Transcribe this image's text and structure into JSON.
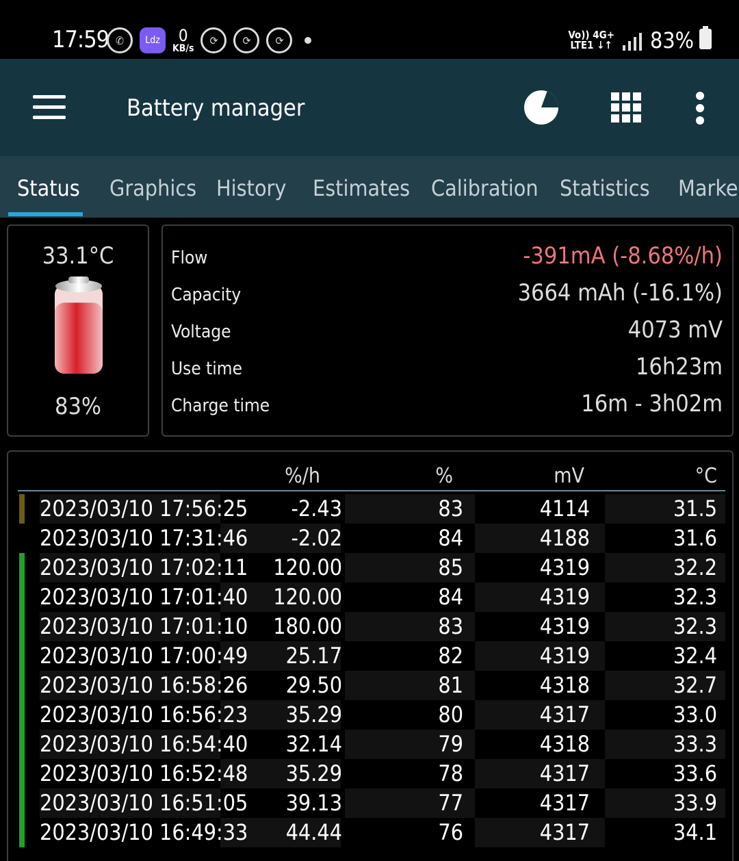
{
  "status_bar": {
    "time": "17:59",
    "net_speed_value": "0",
    "net_speed_unit": "KB/s",
    "ldz_label": "Ldz",
    "network_top": "Vo)) 4G+",
    "network_bottom": "LTE1 ↓↑",
    "battery_percent": "83%",
    "icons": [
      "whatsapp-icon",
      "ldz-app-icon",
      "sync-icon",
      "sync-icon",
      "sync-icon",
      "dot-icon",
      "signal-icon",
      "battery-icon"
    ]
  },
  "app_bar": {
    "title": "Battery manager",
    "icons": [
      "menu-icon",
      "pie-chart-icon",
      "grid-icon",
      "more-vert-icon"
    ]
  },
  "tabs": [
    {
      "label": "Status",
      "active": true
    },
    {
      "label": "Graphics"
    },
    {
      "label": "History"
    },
    {
      "label": "Estimates"
    },
    {
      "label": "Calibration"
    },
    {
      "label": "Statistics"
    },
    {
      "label": "Marker"
    }
  ],
  "battery_summary": {
    "temperature": "33.1°C",
    "level": "83%",
    "level_fraction": 0.83
  },
  "details": [
    {
      "label": "Flow",
      "value": "-391mA (-8.68%/h)"
    },
    {
      "label": "Capacity",
      "value": "3664 mAh (-16.1%)"
    },
    {
      "label": "Voltage",
      "value": "4073 mV"
    },
    {
      "label": "Use time",
      "value": "16h23m"
    },
    {
      "label": "Charge time",
      "value": "16m - 3h02m"
    }
  ],
  "history_table": {
    "headers": [
      "%/h",
      "%",
      "mV",
      "°C"
    ],
    "rows": [
      {
        "ts": "2023/03/10  17:56:25",
        "rate": "-2.43",
        "pct": "83",
        "mv": "4114",
        "temp": "31.5",
        "marker": "#6b5d12"
      },
      {
        "ts": "2023/03/10  17:31:46",
        "rate": "-2.02",
        "pct": "84",
        "mv": "4188",
        "temp": "31.6",
        "marker": ""
      },
      {
        "ts": "2023/03/10  17:02:11",
        "rate": "120.00",
        "pct": "85",
        "mv": "4319",
        "temp": "32.2",
        "marker": "#1ea12a"
      },
      {
        "ts": "2023/03/10  17:01:40",
        "rate": "120.00",
        "pct": "84",
        "mv": "4319",
        "temp": "32.3",
        "marker": "#1ea12a"
      },
      {
        "ts": "2023/03/10  17:01:10",
        "rate": "180.00",
        "pct": "83",
        "mv": "4319",
        "temp": "32.3",
        "marker": "#1ea12a"
      },
      {
        "ts": "2023/03/10  17:00:49",
        "rate": "25.17",
        "pct": "82",
        "mv": "4319",
        "temp": "32.4",
        "marker": "#1ea12a"
      },
      {
        "ts": "2023/03/10  16:58:26",
        "rate": "29.50",
        "pct": "81",
        "mv": "4318",
        "temp": "32.7",
        "marker": "#1ea12a"
      },
      {
        "ts": "2023/03/10  16:56:23",
        "rate": "35.29",
        "pct": "80",
        "mv": "4317",
        "temp": "33.0",
        "marker": "#1ea12a"
      },
      {
        "ts": "2023/03/10  16:54:40",
        "rate": "32.14",
        "pct": "79",
        "mv": "4318",
        "temp": "33.3",
        "marker": "#1ea12a"
      },
      {
        "ts": "2023/03/10  16:52:48",
        "rate": "35.29",
        "pct": "78",
        "mv": "4317",
        "temp": "33.6",
        "marker": "#1ea12a"
      },
      {
        "ts": "2023/03/10  16:51:05",
        "rate": "39.13",
        "pct": "77",
        "mv": "4317",
        "temp": "33.9",
        "marker": "#1ea12a"
      },
      {
        "ts": "2023/03/10  16:49:33",
        "rate": "44.44",
        "pct": "76",
        "mv": "4317",
        "temp": "34.1",
        "marker": "#1ea12a"
      }
    ]
  },
  "colors": {
    "app_bar_bg": "#153541",
    "tab_bar_bg": "#223f4a",
    "tab_indicator": "#2ea4d4",
    "flow_negative": "#ee7676"
  }
}
